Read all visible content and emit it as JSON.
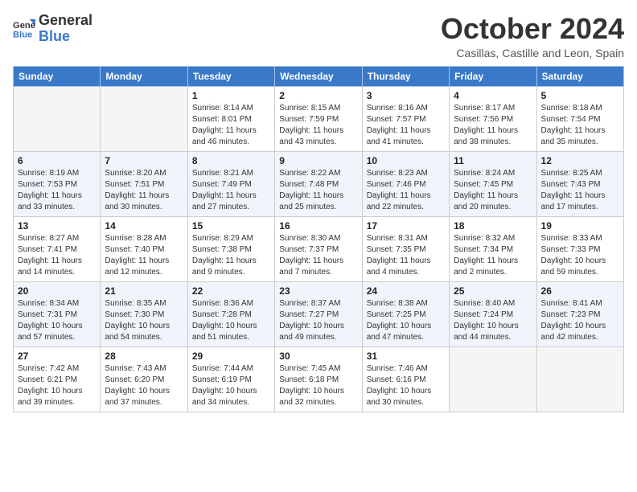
{
  "header": {
    "logo_general": "General",
    "logo_blue": "Blue",
    "month": "October 2024",
    "location": "Casillas, Castille and Leon, Spain"
  },
  "days_of_week": [
    "Sunday",
    "Monday",
    "Tuesday",
    "Wednesday",
    "Thursday",
    "Friday",
    "Saturday"
  ],
  "weeks": [
    [
      {
        "day": "",
        "info": ""
      },
      {
        "day": "",
        "info": ""
      },
      {
        "day": "1",
        "info": "Sunrise: 8:14 AM\nSunset: 8:01 PM\nDaylight: 11 hours and 46 minutes."
      },
      {
        "day": "2",
        "info": "Sunrise: 8:15 AM\nSunset: 7:59 PM\nDaylight: 11 hours and 43 minutes."
      },
      {
        "day": "3",
        "info": "Sunrise: 8:16 AM\nSunset: 7:57 PM\nDaylight: 11 hours and 41 minutes."
      },
      {
        "day": "4",
        "info": "Sunrise: 8:17 AM\nSunset: 7:56 PM\nDaylight: 11 hours and 38 minutes."
      },
      {
        "day": "5",
        "info": "Sunrise: 8:18 AM\nSunset: 7:54 PM\nDaylight: 11 hours and 35 minutes."
      }
    ],
    [
      {
        "day": "6",
        "info": "Sunrise: 8:19 AM\nSunset: 7:53 PM\nDaylight: 11 hours and 33 minutes."
      },
      {
        "day": "7",
        "info": "Sunrise: 8:20 AM\nSunset: 7:51 PM\nDaylight: 11 hours and 30 minutes."
      },
      {
        "day": "8",
        "info": "Sunrise: 8:21 AM\nSunset: 7:49 PM\nDaylight: 11 hours and 27 minutes."
      },
      {
        "day": "9",
        "info": "Sunrise: 8:22 AM\nSunset: 7:48 PM\nDaylight: 11 hours and 25 minutes."
      },
      {
        "day": "10",
        "info": "Sunrise: 8:23 AM\nSunset: 7:46 PM\nDaylight: 11 hours and 22 minutes."
      },
      {
        "day": "11",
        "info": "Sunrise: 8:24 AM\nSunset: 7:45 PM\nDaylight: 11 hours and 20 minutes."
      },
      {
        "day": "12",
        "info": "Sunrise: 8:25 AM\nSunset: 7:43 PM\nDaylight: 11 hours and 17 minutes."
      }
    ],
    [
      {
        "day": "13",
        "info": "Sunrise: 8:27 AM\nSunset: 7:41 PM\nDaylight: 11 hours and 14 minutes."
      },
      {
        "day": "14",
        "info": "Sunrise: 8:28 AM\nSunset: 7:40 PM\nDaylight: 11 hours and 12 minutes."
      },
      {
        "day": "15",
        "info": "Sunrise: 8:29 AM\nSunset: 7:38 PM\nDaylight: 11 hours and 9 minutes."
      },
      {
        "day": "16",
        "info": "Sunrise: 8:30 AM\nSunset: 7:37 PM\nDaylight: 11 hours and 7 minutes."
      },
      {
        "day": "17",
        "info": "Sunrise: 8:31 AM\nSunset: 7:35 PM\nDaylight: 11 hours and 4 minutes."
      },
      {
        "day": "18",
        "info": "Sunrise: 8:32 AM\nSunset: 7:34 PM\nDaylight: 11 hours and 2 minutes."
      },
      {
        "day": "19",
        "info": "Sunrise: 8:33 AM\nSunset: 7:33 PM\nDaylight: 10 hours and 59 minutes."
      }
    ],
    [
      {
        "day": "20",
        "info": "Sunrise: 8:34 AM\nSunset: 7:31 PM\nDaylight: 10 hours and 57 minutes."
      },
      {
        "day": "21",
        "info": "Sunrise: 8:35 AM\nSunset: 7:30 PM\nDaylight: 10 hours and 54 minutes."
      },
      {
        "day": "22",
        "info": "Sunrise: 8:36 AM\nSunset: 7:28 PM\nDaylight: 10 hours and 51 minutes."
      },
      {
        "day": "23",
        "info": "Sunrise: 8:37 AM\nSunset: 7:27 PM\nDaylight: 10 hours and 49 minutes."
      },
      {
        "day": "24",
        "info": "Sunrise: 8:38 AM\nSunset: 7:25 PM\nDaylight: 10 hours and 47 minutes."
      },
      {
        "day": "25",
        "info": "Sunrise: 8:40 AM\nSunset: 7:24 PM\nDaylight: 10 hours and 44 minutes."
      },
      {
        "day": "26",
        "info": "Sunrise: 8:41 AM\nSunset: 7:23 PM\nDaylight: 10 hours and 42 minutes."
      }
    ],
    [
      {
        "day": "27",
        "info": "Sunrise: 7:42 AM\nSunset: 6:21 PM\nDaylight: 10 hours and 39 minutes."
      },
      {
        "day": "28",
        "info": "Sunrise: 7:43 AM\nSunset: 6:20 PM\nDaylight: 10 hours and 37 minutes."
      },
      {
        "day": "29",
        "info": "Sunrise: 7:44 AM\nSunset: 6:19 PM\nDaylight: 10 hours and 34 minutes."
      },
      {
        "day": "30",
        "info": "Sunrise: 7:45 AM\nSunset: 6:18 PM\nDaylight: 10 hours and 32 minutes."
      },
      {
        "day": "31",
        "info": "Sunrise: 7:46 AM\nSunset: 6:16 PM\nDaylight: 10 hours and 30 minutes."
      },
      {
        "day": "",
        "info": ""
      },
      {
        "day": "",
        "info": ""
      }
    ]
  ]
}
